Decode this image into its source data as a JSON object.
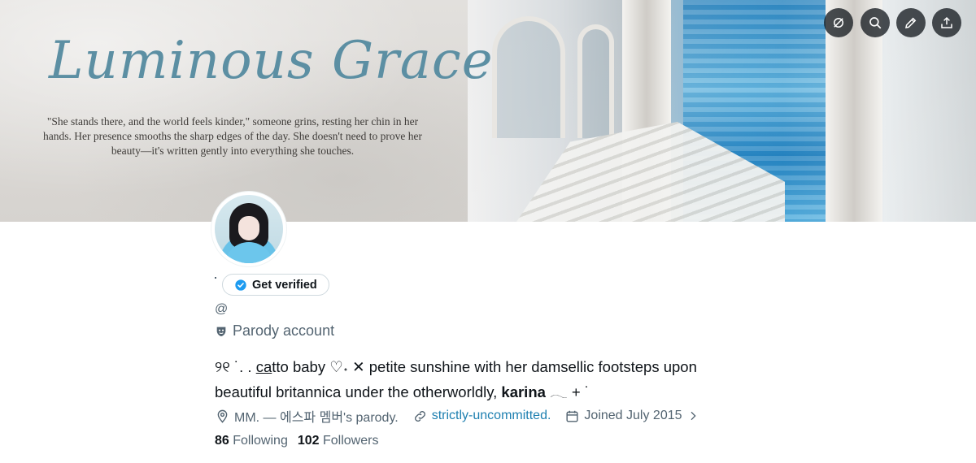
{
  "banner": {
    "title": "Luminous  Grace",
    "quote": "\"She stands there, and the world feels kinder,\" someone grins, resting her chin in her hands. Her presence smooths the sharp edges of the day. She doesn't need to prove her beauty—it's written gently into everything she touches."
  },
  "top_actions": [
    {
      "icon": "grok-icon"
    },
    {
      "icon": "search-icon"
    },
    {
      "icon": "edit-icon"
    },
    {
      "icon": "share-icon"
    }
  ],
  "profile": {
    "get_verified_label": "Get verified",
    "handle": "@",
    "parody_label": "Parody account",
    "bio_line1_prefix": "୨୧ ˙. . ",
    "bio_line1_underlined": "ca",
    "bio_line1_rest": "tto baby ♡˖ ✕ petite sunshine with her damsellic footsteps upon",
    "bio_line2_prefix": "beautiful britannica under the otherworldly, ",
    "bio_line2_bold": "karina",
    "bio_line2_suffix": " 𓂃 + ˙",
    "location": "MM. — 에스파 멤버's parody.",
    "website": "strictly-uncommitted.",
    "joined": "Joined July 2015",
    "following_count": "86",
    "following_label": "Following",
    "followers_count": "102",
    "followers_label": "Followers"
  },
  "colors": {
    "accent": "#1d9bf0",
    "secondary_text": "#536471",
    "title_blue": "#5c8fa3"
  }
}
